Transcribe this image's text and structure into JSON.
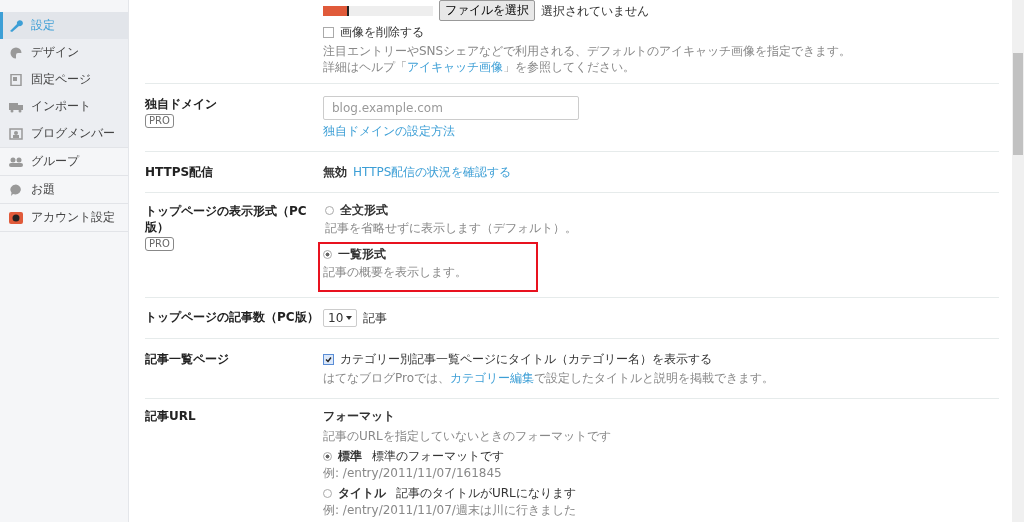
{
  "sidebar": {
    "items": [
      {
        "label": "設定",
        "selected": true
      },
      {
        "label": "デザイン",
        "selected": false
      },
      {
        "label": "固定ページ",
        "selected": false
      },
      {
        "label": "インポート",
        "selected": false
      },
      {
        "label": "ブログメンバー",
        "selected": false
      }
    ],
    "extra_items": [
      {
        "label": "グループ",
        "selected": false
      },
      {
        "label": "お題",
        "selected": false
      },
      {
        "label": "アカウント設定",
        "selected": false
      }
    ]
  },
  "eyecatch": {
    "file_button": "ファイルを選択",
    "file_status": "選択されていません",
    "delete_checkbox": {
      "label": "画像を削除する",
      "checked": false
    },
    "help_line": "注目エントリーやSNSシェアなどで利用される、デフォルトのアイキャッチ画像を指定できます。",
    "help_prefix": "詳細はヘルプ「",
    "help_link": "アイキャッチ画像",
    "help_suffix": "」を参照してください。"
  },
  "domain": {
    "label": "独自ドメイン",
    "badge": "PRO",
    "placeholder": "blog.example.com",
    "link": "独自ドメインの設定方法"
  },
  "https": {
    "label": "HTTPS配信",
    "status": "無効",
    "link": "HTTPS配信の状況を確認する"
  },
  "top_display": {
    "label": "トップページの表示形式（PC版）",
    "badge": "PRO",
    "options": [
      {
        "title": "全文形式",
        "description": "記事を省略せずに表示します（デフォルト）。",
        "selected": false,
        "highlighted": false
      },
      {
        "title": "一覧形式",
        "description": "記事の概要を表示します。",
        "selected": true,
        "highlighted": true
      }
    ]
  },
  "top_count": {
    "label": "トップページの記事数（PC版）",
    "value": "10",
    "unit": "記事"
  },
  "list_page": {
    "label": "記事一覧ページ",
    "checkbox": {
      "label": "カテゴリー別記事一覧ページにタイトル（カテゴリー名）を表示する",
      "checked": true
    },
    "note_prefix": "はてなブログProでは、",
    "note_link": "カテゴリー編集",
    "note_suffix": "で設定したタイトルと説明を掲載できます。"
  },
  "article_url": {
    "label": "記事URL",
    "heading": "フォーマット",
    "description": "記事のURLを指定していないときのフォーマットです",
    "options": [
      {
        "title": "標準",
        "description": "標準のフォーマットです",
        "example": "例: /entry/2011/11/07/161845",
        "selected": true
      },
      {
        "title": "タイトル",
        "description": "記事のタイトルがURLになります",
        "example": "例: /entry/2011/11/07/週末は川に行きました",
        "selected": false
      }
    ]
  }
}
